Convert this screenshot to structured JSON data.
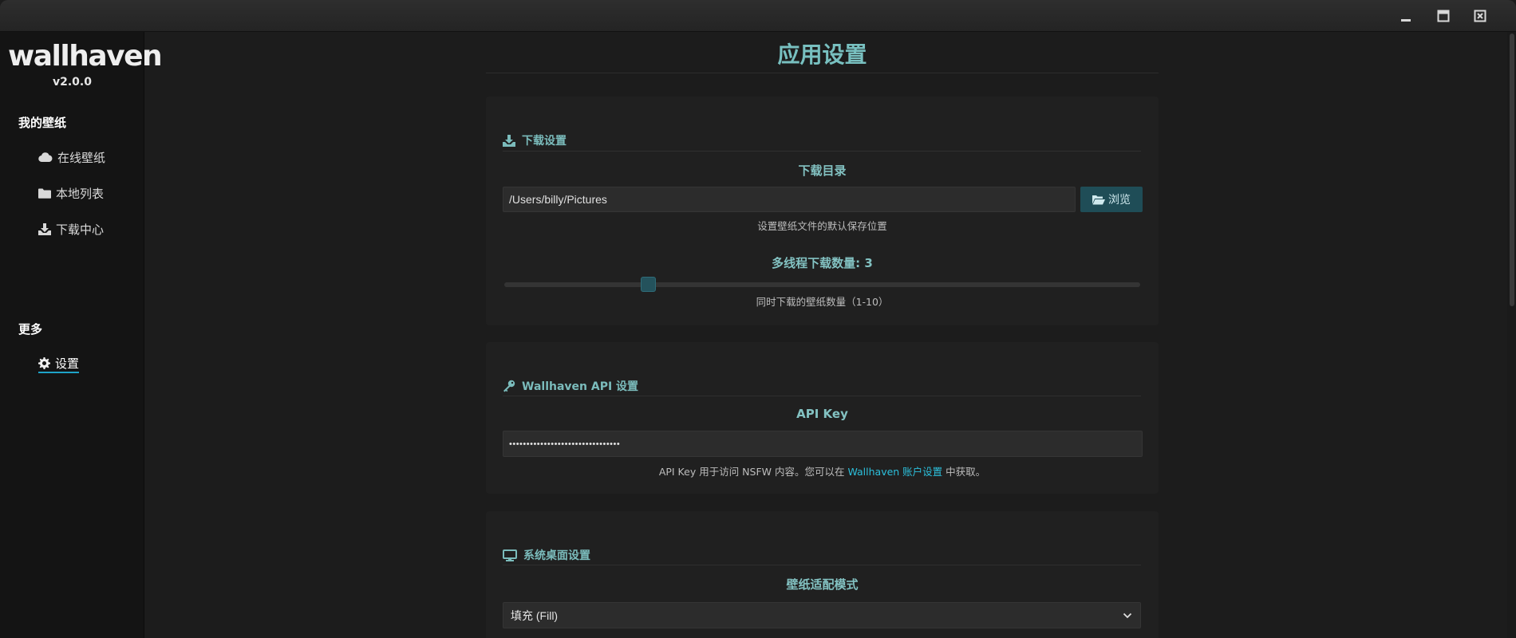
{
  "window": {
    "controls": [
      "minimize-icon",
      "maximize-icon",
      "close-icon"
    ]
  },
  "sidebar": {
    "logo": "wallhaven",
    "version": "v2.0.0",
    "section_my": "我的壁纸",
    "items": [
      {
        "label": "在线壁纸",
        "icon": "cloud-icon"
      },
      {
        "label": "本地列表",
        "icon": "folder-icon"
      },
      {
        "label": "下载中心",
        "icon": "download-icon"
      }
    ],
    "section_more": "更多",
    "settings": {
      "label": "设置",
      "icon": "gear-icon"
    }
  },
  "main": {
    "title": "应用设置",
    "download": {
      "heading": "下载设置",
      "dir_label": "下载目录",
      "dir_value": "/Users/billy/Pictures",
      "browse_label": "浏览",
      "dir_help": "设置壁纸文件的默认保存位置",
      "threads_label": "多线程下载数量: 3",
      "threads_value": 3,
      "threads_min": 1,
      "threads_max": 10,
      "threads_help": "同时下载的壁纸数量（1-10）"
    },
    "api": {
      "heading": "Wallhaven API 设置",
      "key_label": "API Key",
      "key_value": "••••••••••••••••••••••••••••••••",
      "help_prefix": "API Key 用于访问 NSFW 内容。您可以在 ",
      "help_link": "Wallhaven 账户设置",
      "help_suffix": " 中获取。"
    },
    "desktop": {
      "heading": "系统桌面设置",
      "mode_label": "壁纸适配模式",
      "mode_value": "填充 (Fill)"
    }
  },
  "colors": {
    "accent": "#78c0c0",
    "link": "#2cc0dc",
    "button": "#1f4d57"
  }
}
